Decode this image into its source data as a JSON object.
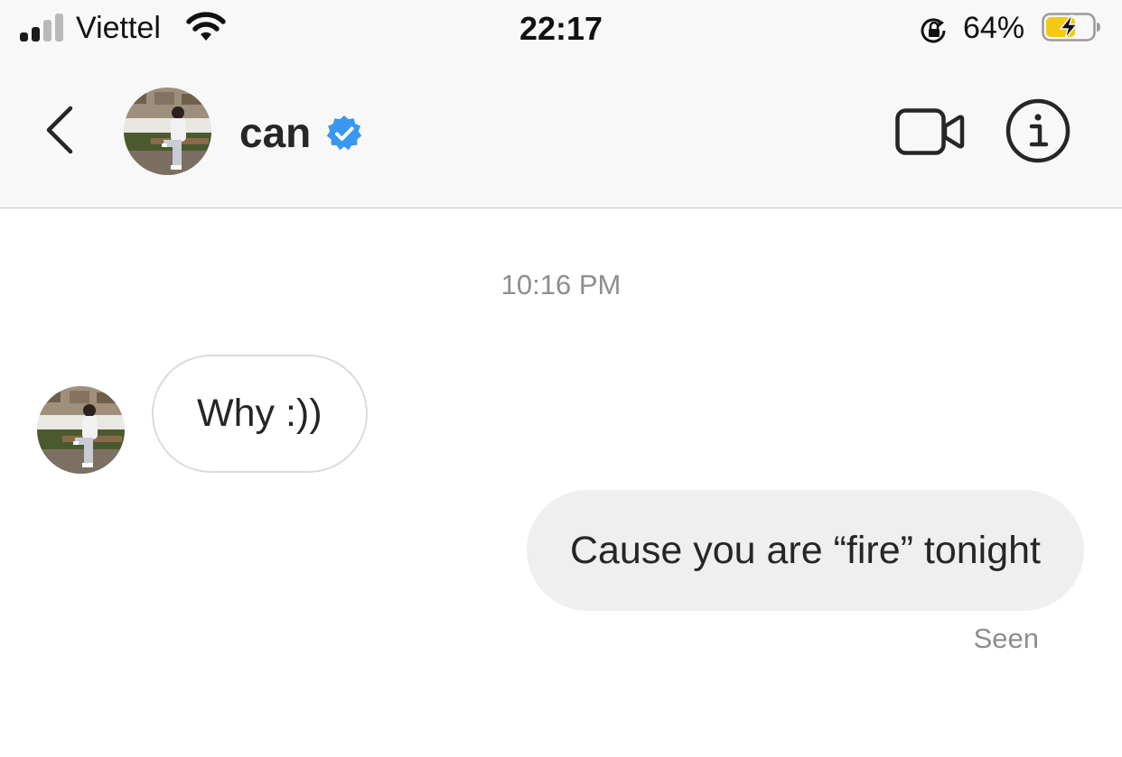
{
  "status_bar": {
    "carrier": "Viettel",
    "time": "22:17",
    "battery_percent": "64%",
    "signal_bars_active": 2,
    "signal_bars_total": 4,
    "charging": true,
    "battery_level": 0.64,
    "colors": {
      "battery_fill": "#f4c90f",
      "text": "#111111"
    }
  },
  "header": {
    "username": "can",
    "verified": true,
    "icons": [
      "chevron-left-icon",
      "video-camera-icon",
      "info-icon",
      "verified-badge-icon"
    ],
    "colors": {
      "verified": "#3897f0",
      "background": "#f8f8f8"
    }
  },
  "thread": {
    "timestamp": "10:16 PM",
    "messages": [
      {
        "direction": "incoming",
        "text": "Why :))"
      },
      {
        "direction": "outgoing",
        "text": "Cause you are “fire” tonight"
      }
    ],
    "seen_label": "Seen"
  }
}
